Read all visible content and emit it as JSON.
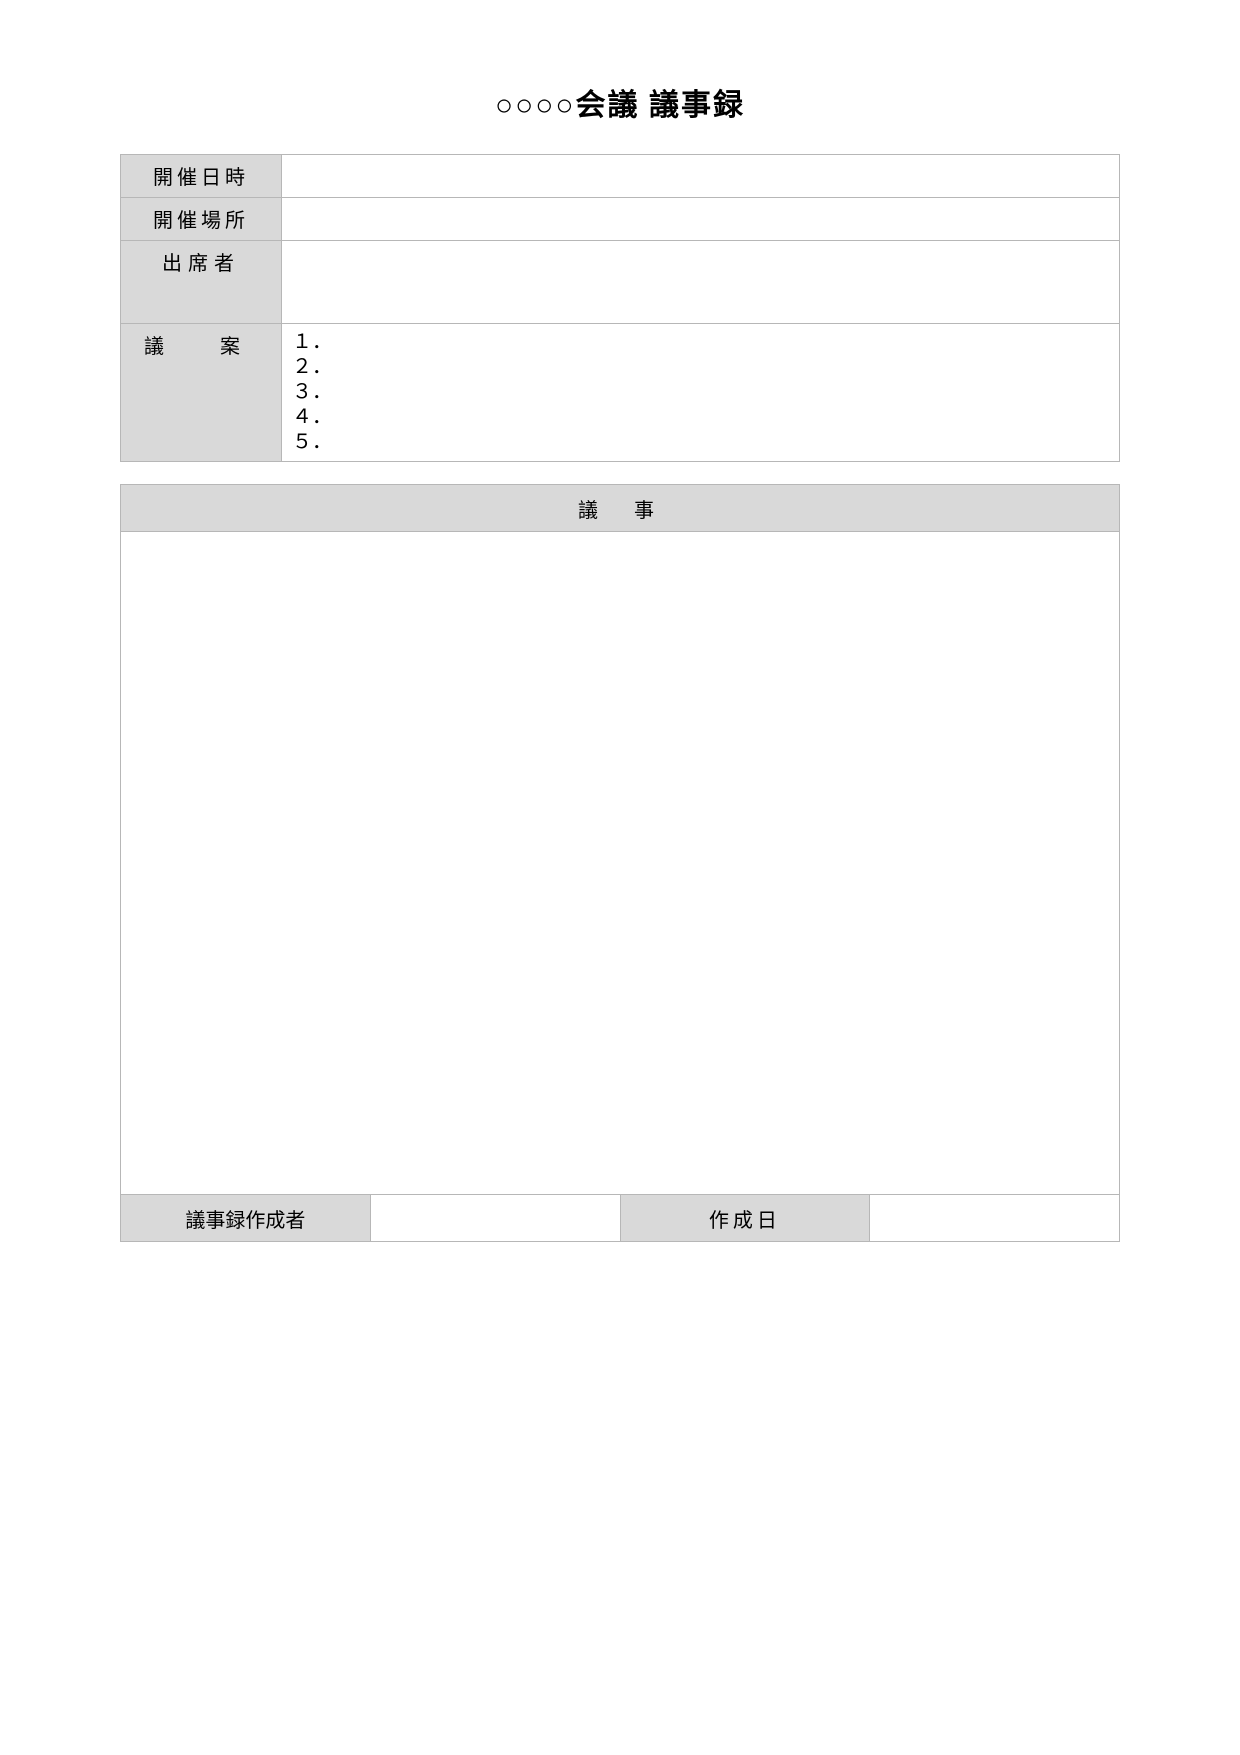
{
  "title": "○○○○会議 議事録",
  "info": {
    "date_label": "開催日時",
    "date_value": "",
    "place_label": "開催場所",
    "place_value": "",
    "attendees_label": "出席者",
    "attendees_value": "",
    "agenda_label": "議　案",
    "agenda_items": [
      "１．",
      "２．",
      "３．",
      "４．",
      "５．"
    ]
  },
  "proceedings": {
    "header": "議　事",
    "body": "",
    "author_label": "議事録作成者",
    "author_value": "",
    "created_label": "作成日",
    "created_value": ""
  }
}
